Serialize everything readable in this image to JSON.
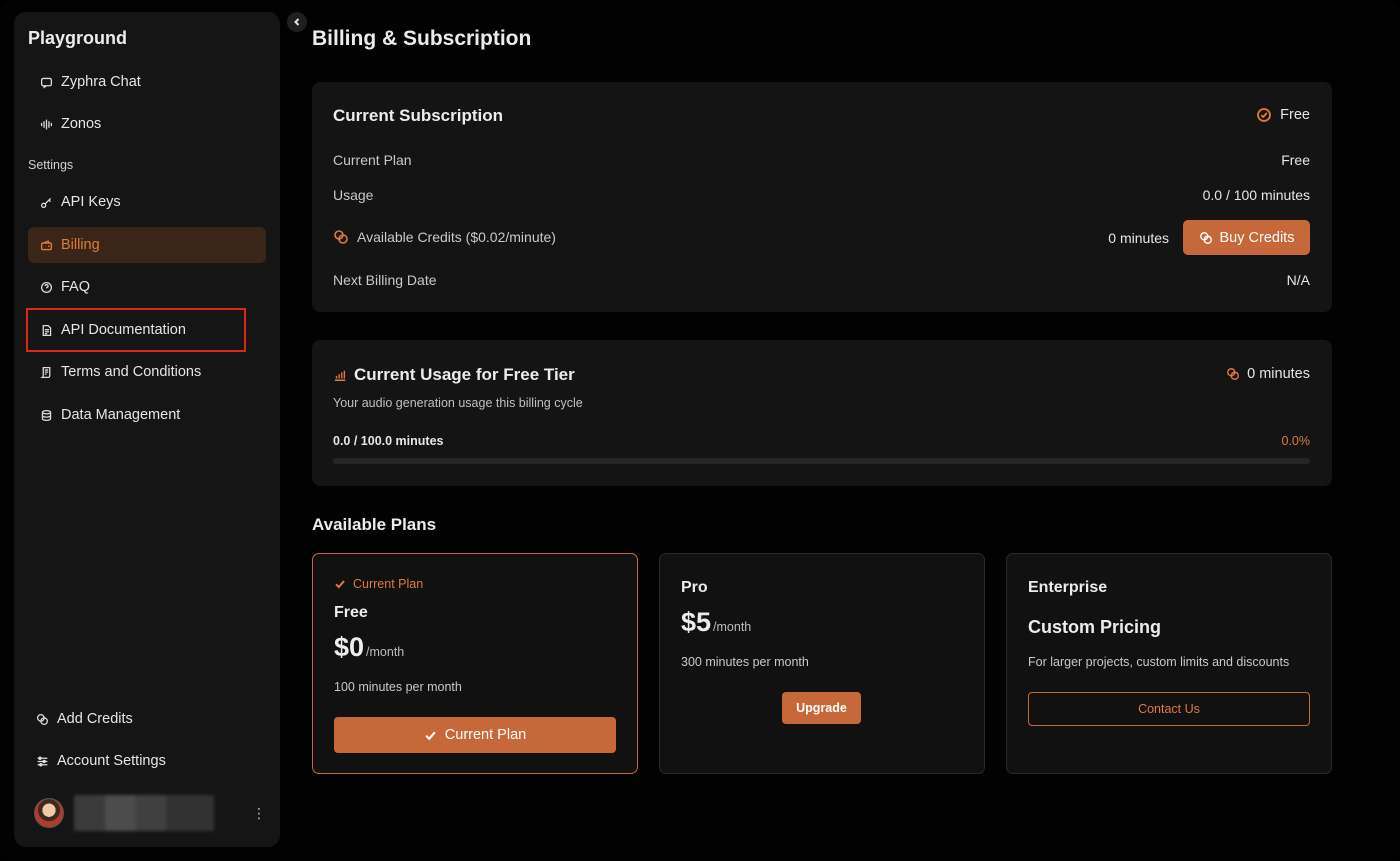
{
  "sidebar": {
    "title": "Playground",
    "section_settings": "Settings",
    "items": [
      {
        "label": "Zyphra Chat",
        "icon": "chat-icon"
      },
      {
        "label": "Zonos",
        "icon": "audio-wave-icon"
      },
      {
        "label": "API Keys",
        "icon": "key-icon"
      },
      {
        "label": "Billing",
        "icon": "wallet-icon",
        "active": true
      },
      {
        "label": "FAQ",
        "icon": "help-circle-icon"
      },
      {
        "label": "API Documentation",
        "icon": "document-icon",
        "highlighted": true
      },
      {
        "label": "Terms and Conditions",
        "icon": "scroll-icon"
      },
      {
        "label": "Data Management",
        "icon": "database-icon"
      }
    ],
    "bottom_items": [
      {
        "label": "Add Credits",
        "icon": "coins-icon"
      },
      {
        "label": "Account Settings",
        "icon": "sliders-icon"
      }
    ],
    "user_menu": "⋮"
  },
  "page": {
    "title": "Billing & Subscription"
  },
  "subscription": {
    "title": "Current Subscription",
    "badge": "Free",
    "rows": {
      "current_plan_label": "Current Plan",
      "current_plan_value": "Free",
      "usage_label": "Usage",
      "usage_value": "0.0 / 100 minutes",
      "credits_label": "Available Credits ($0.02/minute)",
      "credits_value": "0 minutes",
      "next_billing_label": "Next Billing Date",
      "next_billing_value": "N/A"
    },
    "buy_button": "Buy Credits"
  },
  "usage": {
    "title": "Current Usage for Free Tier",
    "right_value": "0 minutes",
    "subtitle": "Your audio generation usage this billing cycle",
    "count": "0.0 / 100.0 minutes",
    "percent": "0.0%",
    "progress_fraction": 0.0
  },
  "plans": {
    "title": "Available Plans",
    "free": {
      "tag": "Current Plan",
      "name": "Free",
      "price": "$0",
      "period": "/month",
      "desc": "100 minutes per month",
      "cta": "Current Plan"
    },
    "pro": {
      "name": "Pro",
      "price": "$5",
      "period": "/month",
      "desc": "300 minutes per month",
      "cta": "Upgrade"
    },
    "enterprise": {
      "name": "Enterprise",
      "subtitle": "Custom Pricing",
      "desc": "For larger projects, custom limits and discounts",
      "cta": "Contact Us"
    }
  },
  "colors": {
    "accent": "#e07a3a",
    "button": "#c7683a",
    "highlight_box": "#e0251b"
  }
}
